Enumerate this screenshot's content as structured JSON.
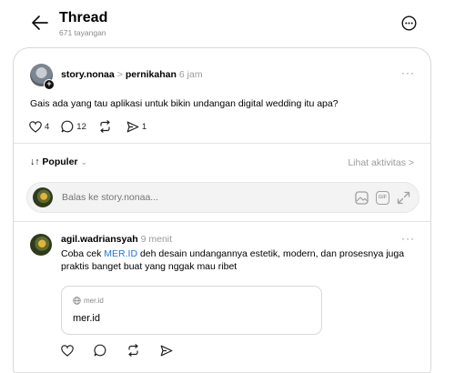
{
  "header": {
    "title": "Thread",
    "views": "671 tayangan"
  },
  "post": {
    "username": "story.nonaa",
    "separator": ">",
    "topic": "pernikahan",
    "time": "6 jam",
    "text": "Gais ada yang tau aplikasi untuk bikin undangan digital wedding itu apa?",
    "likes": "4",
    "replies": "12",
    "reposts": "",
    "shares": "1"
  },
  "sort": {
    "label": "↓↑ Populer",
    "chevron": "⌄",
    "activity_link": "Lihat aktivitas >"
  },
  "reply_box": {
    "placeholder": "Balas ke story.nonaa...",
    "gif_label": "GIF"
  },
  "comment": {
    "username": "agil.wadriansyah",
    "time": "9 menit",
    "text_before": "Coba cek ",
    "link_text": "MER.ID",
    "text_after": " deh desain undangannya estetik, modern, dan prosesnya juga praktis banget buat yang nggak mau ribet",
    "preview_domain": "mer.id",
    "preview_title": "mer.id"
  },
  "ui": {
    "more_glyph": "···"
  },
  "colors": {
    "link": "#1f74d6",
    "muted": "#9a9a9a",
    "border": "#d8d8d8"
  }
}
